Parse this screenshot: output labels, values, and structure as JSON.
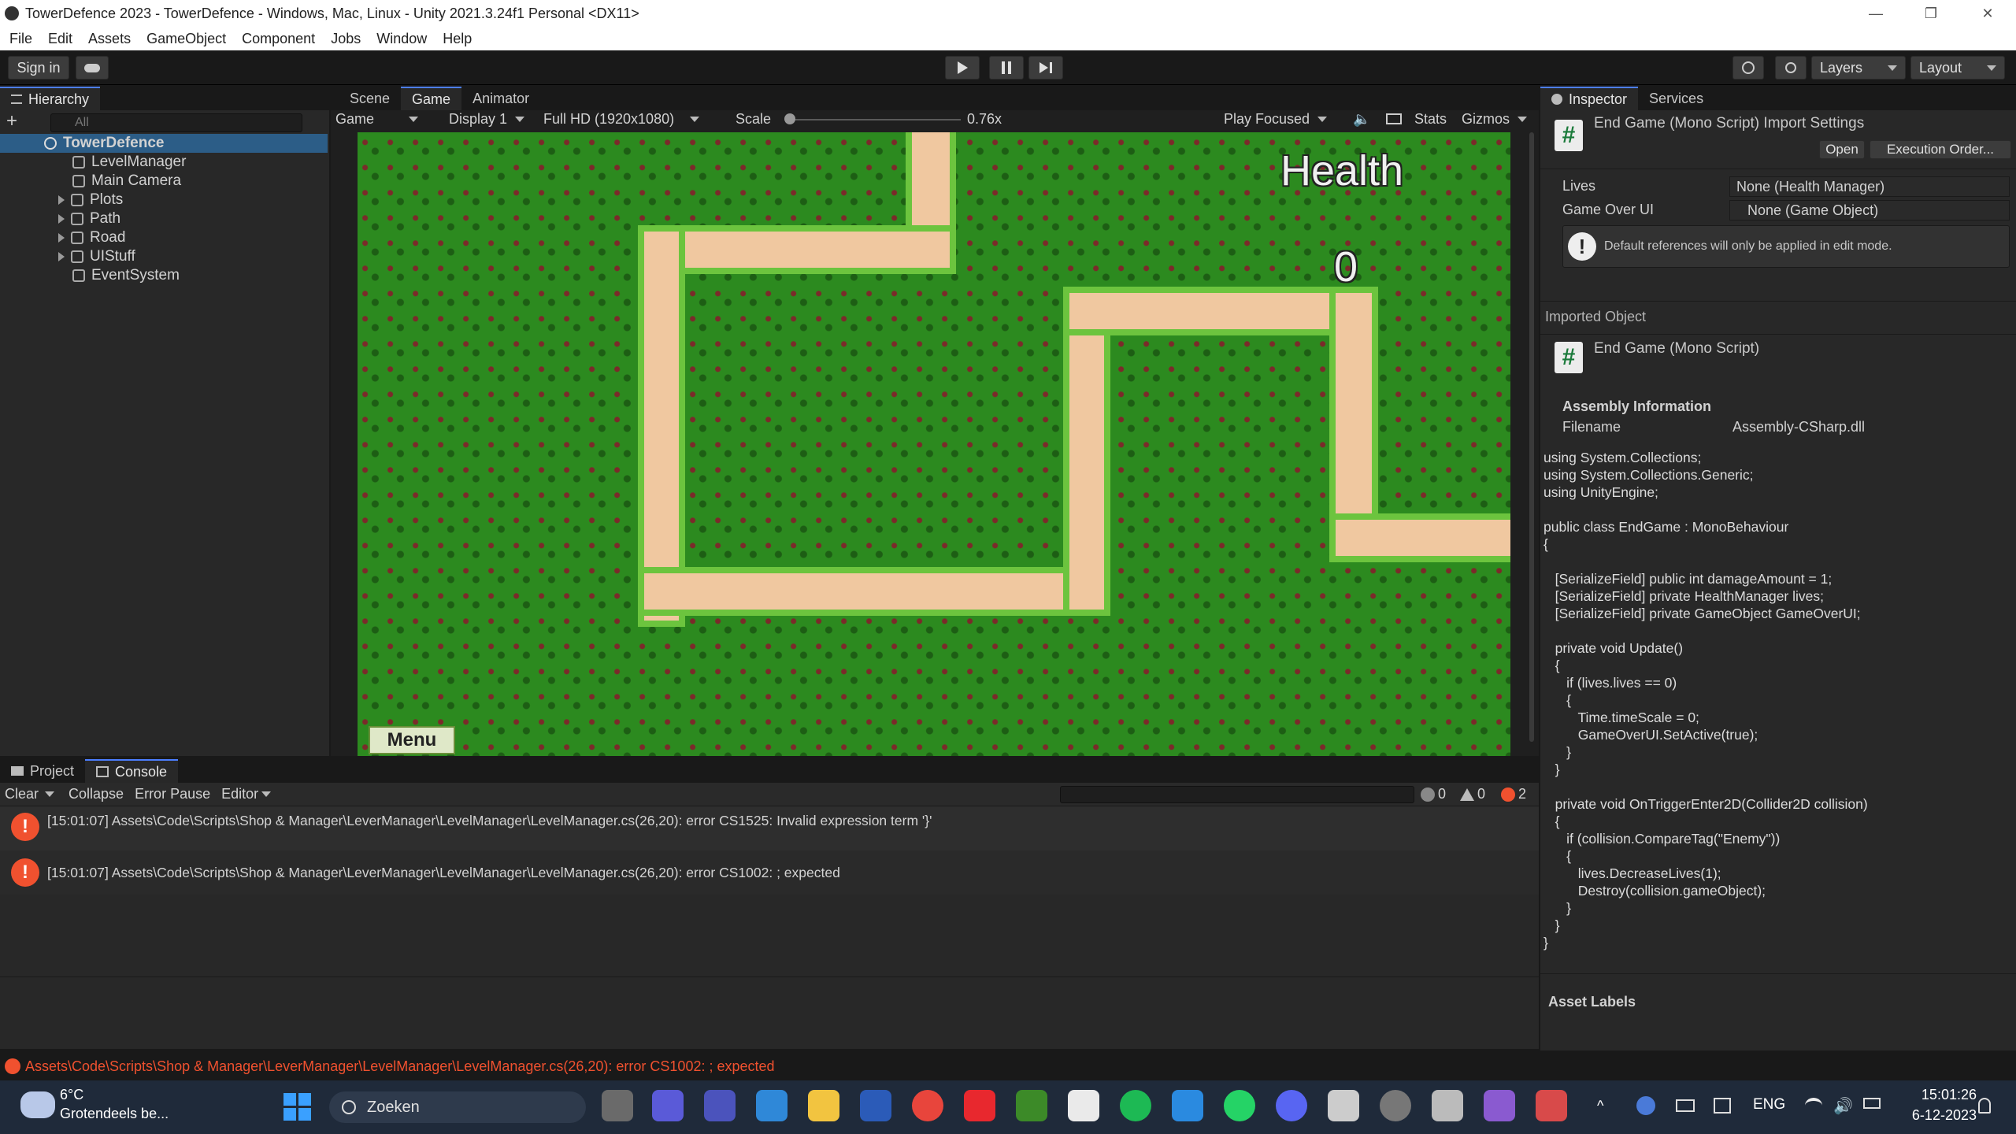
{
  "window": {
    "title": "TowerDefence 2023 - TowerDefence - Windows, Mac, Linux - Unity 2021.3.24f1 Personal <DX11>",
    "controls": [
      "—",
      "❐",
      "✕"
    ]
  },
  "menu": [
    "File",
    "Edit",
    "Assets",
    "GameObject",
    "Component",
    "Jobs",
    "Window",
    "Help"
  ],
  "toolbar": {
    "sign_in": "Sign in",
    "layers": "Layers",
    "layout": "Layout"
  },
  "hierarchy": {
    "tab": "Hierarchy",
    "search_placeholder": "All",
    "root": "TowerDefence",
    "items": [
      {
        "label": "LevelManager",
        "expandable": false
      },
      {
        "label": "Main Camera",
        "expandable": false
      },
      {
        "label": "Plots",
        "expandable": true
      },
      {
        "label": "Path",
        "expandable": true
      },
      {
        "label": "Road",
        "expandable": true
      },
      {
        "label": "UIStuff",
        "expandable": true
      },
      {
        "label": "EventSystem",
        "expandable": false
      }
    ]
  },
  "game_view": {
    "tabs": [
      "Scene",
      "Game",
      "Animator"
    ],
    "mode": "Game",
    "display": "Display 1",
    "resolution": "Full HD (1920x1080)",
    "scale_label": "Scale",
    "scale_value": "0.76x",
    "play_mode": "Play Focused",
    "stats": "Stats",
    "gizmos": "Gizmos",
    "hud_health": "Health",
    "hud_value": "0",
    "menu_button": "Menu"
  },
  "console": {
    "tabs": [
      "Project",
      "Console"
    ],
    "buttons": {
      "clear": "Clear",
      "collapse": "Collapse",
      "error_pause": "Error Pause",
      "editor": "Editor"
    },
    "counts": {
      "info": "0",
      "warnings": "0",
      "errors": "2"
    },
    "messages": [
      "[15:01:07] Assets\\Code\\Scripts\\Shop & Manager\\LeverManager\\LevelManager\\LevelManager.cs(26,20): error CS1525: Invalid expression term '}'",
      "[15:01:07] Assets\\Code\\Scripts\\Shop & Manager\\LeverManager\\LevelManager\\LevelManager.cs(26,20): error CS1002: ; expected"
    ],
    "status_line": "Assets\\Code\\Scripts\\Shop & Manager\\LeverManager\\LevelManager\\LevelManager.cs(26,20): error CS1002: ; expected"
  },
  "inspector": {
    "tabs": [
      "Inspector",
      "Services"
    ],
    "header_title": "End Game (Mono Script) Import Settings",
    "open_button": "Open",
    "exec_order_button": "Execution Order...",
    "fields": [
      {
        "label": "Lives",
        "value": "None (Health Manager)"
      },
      {
        "label": "Game Over UI",
        "value": "None (Game Object)"
      }
    ],
    "help_text": "Default references will only be applied in edit mode.",
    "imported_object_label": "Imported Object",
    "object_title": "End Game (Mono Script)",
    "assembly_title": "Assembly Information",
    "filename_label": "Filename",
    "filename_value": "Assembly-CSharp.dll",
    "code": "using System.Collections;\nusing System.Collections.Generic;\nusing UnityEngine;\n\npublic class EndGame : MonoBehaviour\n{\n\n   [SerializeField] public int damageAmount = 1;\n   [SerializeField] private HealthManager lives;\n   [SerializeField] private GameObject GameOverUI;\n\n   private void Update()\n   {\n      if (lives.lives == 0)\n      {\n         Time.timeScale = 0;\n         GameOverUI.SetActive(true);\n      }\n   }\n\n   private void OnTriggerEnter2D(Collider2D collision)\n   {\n      if (collision.CompareTag(\"Enemy\"))\n      {\n         lives.DecreaseLives(1);\n         Destroy(collision.gameObject);\n      }\n   }\n}",
    "asset_labels": "Asset Labels"
  },
  "taskbar": {
    "temp": "6°C",
    "weather": "Grotendeels be...",
    "search": "Zoeken",
    "lang": "ENG",
    "time": "15:01:26",
    "date": "6-12-2023"
  },
  "colors": {
    "accent": "#4c7eff",
    "error": "#f0512f",
    "grass": "#2c8a1f",
    "path": "#f0c8a0"
  }
}
